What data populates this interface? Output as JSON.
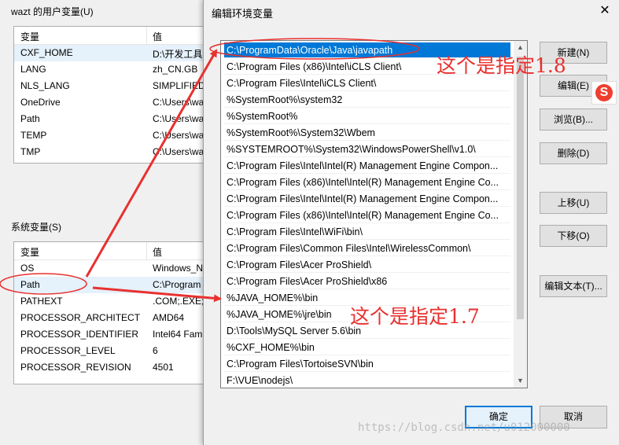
{
  "background_window": {
    "user_vars_label": "wazt 的用户变量(U)",
    "col_var": "变量",
    "col_val": "值",
    "user_vars": [
      {
        "name": "CXF_HOME",
        "value": "D:\\开发工具"
      },
      {
        "name": "LANG",
        "value": "zh_CN.GB"
      },
      {
        "name": "NLS_LANG",
        "value": "SIMPLIFIED"
      },
      {
        "name": "OneDrive",
        "value": "C:\\Users\\wa"
      },
      {
        "name": "Path",
        "value": "C:\\Users\\wa"
      },
      {
        "name": "TEMP",
        "value": "C:\\Users\\wa"
      },
      {
        "name": "TMP",
        "value": "C:\\Users\\wa"
      }
    ],
    "system_vars_label": "系统变量(S)",
    "system_vars": [
      {
        "name": "OS",
        "value": "Windows_N"
      },
      {
        "name": "Path",
        "value": "C:\\Program"
      },
      {
        "name": "PATHEXT",
        "value": ".COM;.EXE;"
      },
      {
        "name": "PROCESSOR_ARCHITECT",
        "value": "AMD64"
      },
      {
        "name": "PROCESSOR_IDENTIFIER",
        "value": "Intel64 Fam"
      },
      {
        "name": "PROCESSOR_LEVEL",
        "value": "6"
      },
      {
        "name": "PROCESSOR_REVISION",
        "value": "4501"
      }
    ]
  },
  "dialog": {
    "title": "编辑环境变量",
    "close_icon": "close-icon",
    "paths": [
      "C:\\ProgramData\\Oracle\\Java\\javapath",
      "C:\\Program Files (x86)\\Intel\\iCLS Client\\",
      "C:\\Program Files\\Intel\\iCLS Client\\",
      "%SystemRoot%\\system32",
      "%SystemRoot%",
      "%SystemRoot%\\System32\\Wbem",
      "%SYSTEMROOT%\\System32\\WindowsPowerShell\\v1.0\\",
      "C:\\Program Files\\Intel\\Intel(R) Management Engine Compon...",
      "C:\\Program Files (x86)\\Intel\\Intel(R) Management Engine Co...",
      "C:\\Program Files\\Intel\\Intel(R) Management Engine Compon...",
      "C:\\Program Files (x86)\\Intel\\Intel(R) Management Engine Co...",
      "C:\\Program Files\\Intel\\WiFi\\bin\\",
      "C:\\Program Files\\Common Files\\Intel\\WirelessCommon\\",
      "C:\\Program Files\\Acer ProShield\\",
      "C:\\Program Files\\Acer ProShield\\x86",
      "%JAVA_HOME%\\bin",
      "%JAVA_HOME%\\jre\\bin",
      "D:\\Tools\\MySQL Server 5.6\\bin",
      "%CXF_HOME%\\bin",
      "C:\\Program Files\\TortoiseSVN\\bin",
      "F:\\VUE\\nodejs\\"
    ],
    "buttons": {
      "new": "新建(N)",
      "edit": "编辑(E)",
      "browse": "浏览(B)...",
      "delete": "删除(D)",
      "move_up": "上移(U)",
      "move_down": "下移(O)",
      "edit_text": "编辑文本(T)...",
      "ok": "确定",
      "cancel": "取消"
    }
  },
  "annotations": {
    "top_note": "这个是指定1.8",
    "bottom_note": "这个是指定1.7",
    "color": "#e8312f"
  },
  "watermark": "https://blog.csdn.net/u012000000",
  "ime_icon_letter": "S"
}
